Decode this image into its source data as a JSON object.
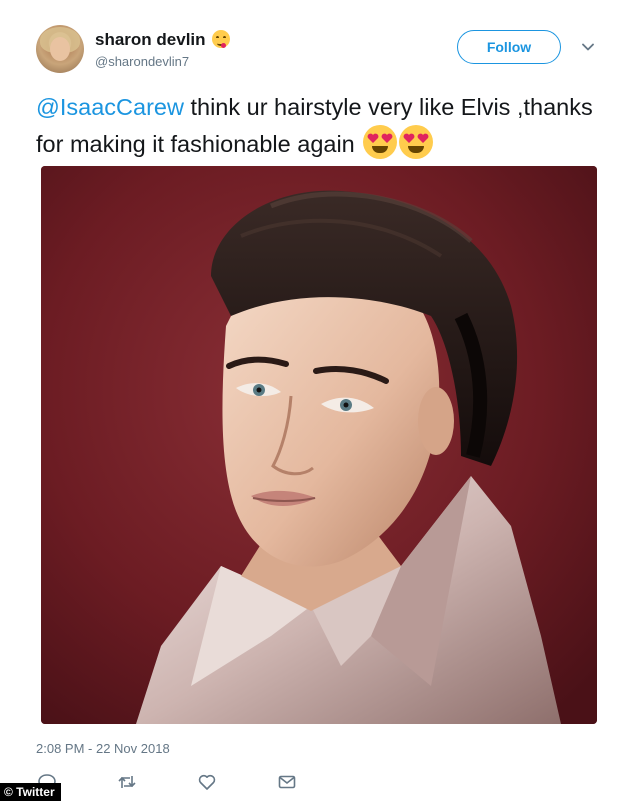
{
  "tweet": {
    "display_name": "sharon devlin",
    "handle": "@sharondevlin7",
    "follow_label": "Follow",
    "text": {
      "mention": "@IsaacCarew",
      "body": " think ur hairstyle very like Elvis ,thanks for making it fashionable again"
    },
    "timestamp": "2:08 PM - 22 Nov 2018"
  },
  "watermark": "© Twitter",
  "colors": {
    "accent": "#1b95e0",
    "text": "#14171a",
    "muted": "#657786",
    "photo_background": "#6f1d24"
  },
  "icons": {
    "name_emoji": "face-savoring-food-emoji",
    "text_emoji": "smiling-face-with-heart-eyes-emoji",
    "menu": "chevron-down-icon",
    "actions": [
      "reply-icon",
      "retweet-icon",
      "like-icon",
      "direct-message-icon"
    ]
  }
}
